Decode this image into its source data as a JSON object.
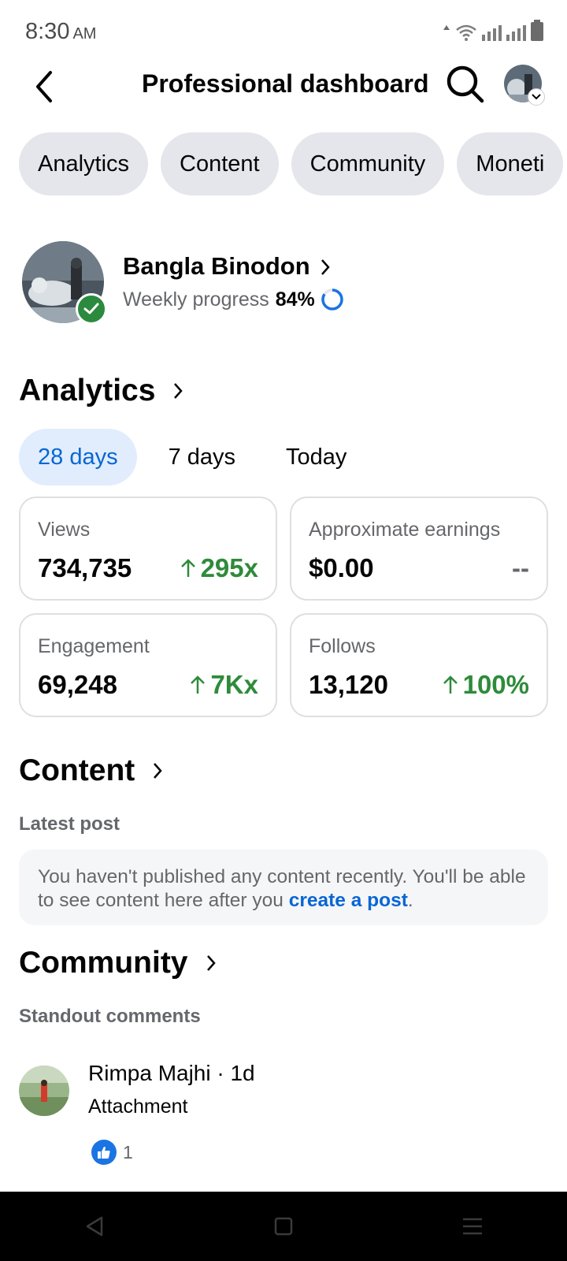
{
  "status_bar": {
    "time": "8:30",
    "ampm": "AM"
  },
  "header": {
    "title": "Professional dashboard",
    "back_icon": "chevron-left-icon",
    "search_icon": "search-icon"
  },
  "tabs": [
    "Analytics",
    "Content",
    "Community",
    "Moneti"
  ],
  "profile": {
    "name": "Bangla Binodon",
    "progress_label": "Weekly progress",
    "progress_value": "84%",
    "progress_fraction": 0.84
  },
  "analytics": {
    "title": "Analytics",
    "ranges": [
      {
        "label": "28 days",
        "active": true
      },
      {
        "label": "7 days",
        "active": false
      },
      {
        "label": "Today",
        "active": false
      }
    ],
    "cards": [
      {
        "label": "Views",
        "value": "734,735",
        "change": "295x",
        "trend": "up"
      },
      {
        "label": "Approximate earnings",
        "value": "$0.00",
        "change": "--",
        "trend": "none"
      },
      {
        "label": "Engagement",
        "value": "69,248",
        "change": "7Kx",
        "trend": "up"
      },
      {
        "label": "Follows",
        "value": "13,120",
        "change": "100%",
        "trend": "up"
      }
    ]
  },
  "content": {
    "title": "Content",
    "subtitle": "Latest post",
    "empty_text": "You haven't published any content recently. You'll be able to see content here after you ",
    "empty_link": "create a post",
    "empty_end": "."
  },
  "community": {
    "title": "Community",
    "subtitle": "Standout comments",
    "comment": {
      "author_line": "Rimpa Majhi · 1d",
      "text": "Attachment",
      "reaction_count": "1"
    }
  },
  "colors": {
    "accent": "#0866d4",
    "positive": "#2e8b3a",
    "chip_bg": "#e4e6eb",
    "active_chip_bg": "#e1edfd"
  }
}
